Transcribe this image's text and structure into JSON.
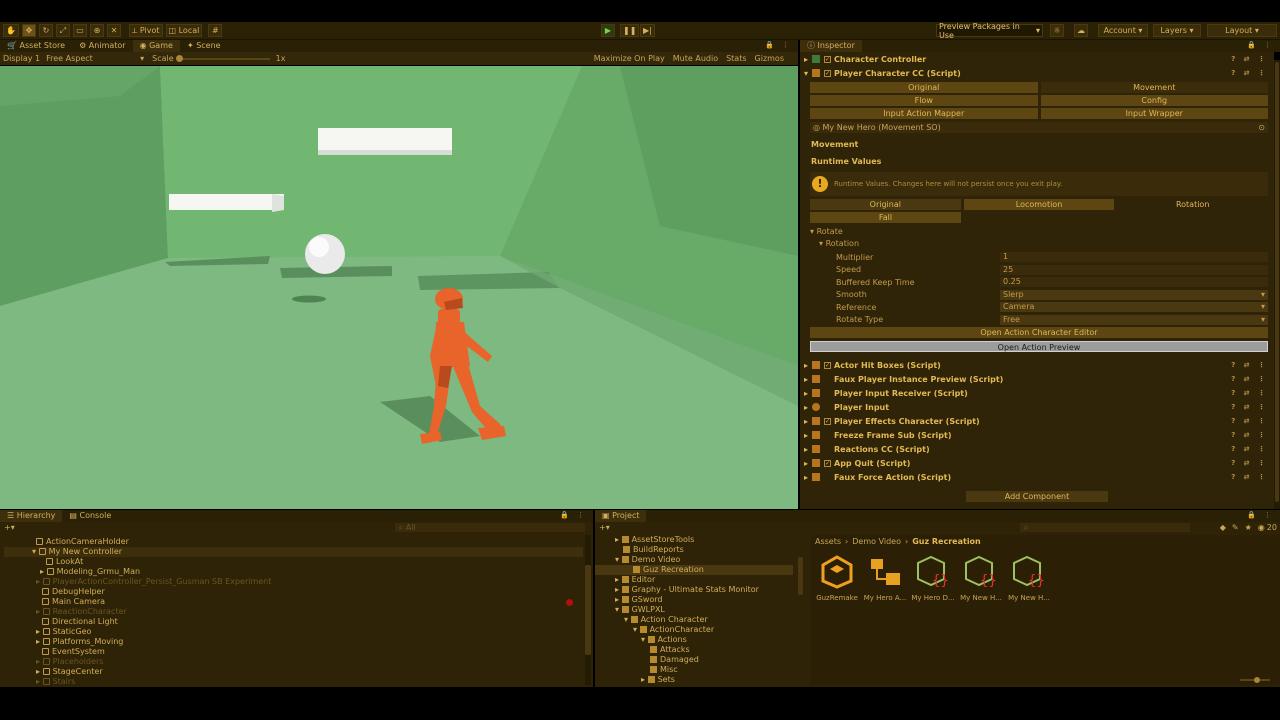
{
  "toolbar": {
    "pivot": "Pivot",
    "local": "Local",
    "preview_packages": "Preview Packages in Use",
    "account": "Account",
    "layers": "Layers",
    "layout": "Layout"
  },
  "scene_tabs": [
    "Asset Store",
    "Animator",
    "Game",
    "Scene"
  ],
  "game_bar": {
    "display": "Display 1",
    "aspect": "Free Aspect",
    "scale_label": "Scale",
    "scale_value": "1x",
    "maximize": "Maximize On Play",
    "mute": "Mute Audio",
    "stats": "Stats",
    "gizmos": "Gizmos"
  },
  "inspector": {
    "tab": "Inspector",
    "component_top": "Character Controller",
    "component_main": "Player Character CC (Script)",
    "tabs_row1": [
      "Original",
      "Movement"
    ],
    "tabs_row2": [
      "Flow",
      "Config"
    ],
    "tabs_row3": [
      "Input Action Mapper",
      "Input Wrapper"
    ],
    "so_field": "My New Hero (Movement SO)",
    "section_movement": "Movement",
    "runtime_values": "Runtime Values",
    "warning": "Runtime Values. Changes here will not persist once you exit play.",
    "subtabs_row1": [
      "Original",
      "Locomotion",
      "Rotation"
    ],
    "subtabs_row2": [
      "Fall"
    ],
    "rotate": "Rotate",
    "rotation": "Rotation",
    "fields": [
      {
        "label": "Multiplier",
        "value": "1"
      },
      {
        "label": "Speed",
        "value": "25"
      },
      {
        "label": "Buffered Keep Time",
        "value": "0.25"
      },
      {
        "label": "Smooth",
        "value": "Slerp"
      },
      {
        "label": "Reference",
        "value": "Camera"
      },
      {
        "label": "Rotate Type",
        "value": "Free"
      }
    ],
    "btn_editor": "Open Action Character Editor",
    "btn_preview": "Open Action Preview",
    "components": [
      "Actor Hit Boxes (Script)",
      "Faux Player Instance Preview (Script)",
      "Player Input Receiver (Script)",
      "Player Input",
      "Player Effects Character (Script)",
      "Freeze Frame Sub (Script)",
      "Reactions CC (Script)",
      "App Quit (Script)",
      "Faux Force Action (Script)"
    ],
    "add_component": "Add Component"
  },
  "hierarchy": {
    "tabs": [
      "Hierarchy",
      "Console"
    ],
    "search_placeholder": "All",
    "items": [
      "ActionCameraHolder",
      "My New Controller",
      "LookAt",
      "Modeling_Grmu_Man",
      "PlayerActionController_Persist_Gusman SB Experiment",
      "DebugHelper",
      "Main Camera",
      "ReactionCharacter",
      "Directional Light",
      "StaticGeo",
      "Platforms_Moving",
      "EventSystem",
      "Placeholders",
      "StageCenter",
      "Stairs"
    ]
  },
  "project": {
    "tab": "Project",
    "tree": [
      "AssetStoreTools",
      "BuildReports",
      "Demo Video",
      "Guz Recreation",
      "Editor",
      "Graphy - Ultimate Stats Monitor",
      "GSword",
      "GWLPXL",
      "Action Character",
      "ActionCharacter",
      "Actions",
      "Attacks",
      "Damaged",
      "Misc",
      "Sets"
    ],
    "breadcrumb": [
      "Assets",
      "Demo Video",
      "Guz Recreation"
    ],
    "count": "20",
    "assets": [
      "GuzRemake",
      "My Hero A...",
      "My Hero D...",
      "My New H...",
      "My New H..."
    ]
  },
  "colors": {
    "accent": "#e2b955",
    "character": "#e8642a",
    "ground": "#78b27c",
    "sky": "#6fb36e"
  }
}
